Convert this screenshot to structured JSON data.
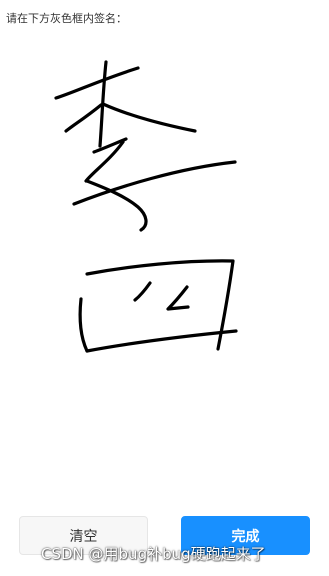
{
  "instruction": "请在下方灰色框内签名：",
  "buttons": {
    "clear_label": "清空",
    "done_label": "完成"
  },
  "watermark": "CSDN @用bug补bug硬跑起来了",
  "colors": {
    "primary": "#1890ff",
    "stroke": "#000000",
    "clear_bg": "#f7f7f7"
  }
}
